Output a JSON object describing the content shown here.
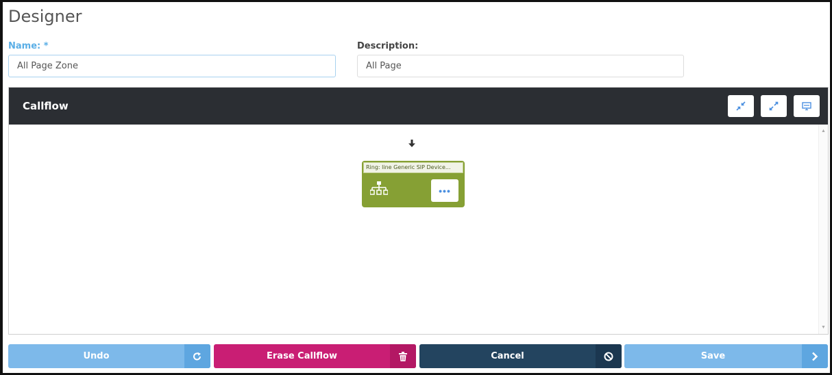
{
  "page": {
    "title": "Designer"
  },
  "form": {
    "name_label": "Name: *",
    "name_value": "All Page Zone",
    "description_label": "Description:",
    "description_value": "All Page"
  },
  "callflow": {
    "title": "Callflow",
    "header_icons": [
      "compress-icon",
      "expand-icon",
      "monitor-icon"
    ],
    "node": {
      "title": "Ring: line Generic SIP Device...",
      "icon": "org-chart-icon",
      "menu_label": "•••"
    }
  },
  "actions": {
    "undo_label": "Undo",
    "erase_label": "Erase Callflow",
    "cancel_label": "Cancel",
    "save_label": "Save"
  },
  "colors": {
    "header_bg": "#2b2e33",
    "node_green": "#86a034",
    "undo_blue": "#7db9ea",
    "erase_magenta": "#c91e74",
    "cancel_navy": "#23445f",
    "save_blue": "#7db9ea"
  }
}
